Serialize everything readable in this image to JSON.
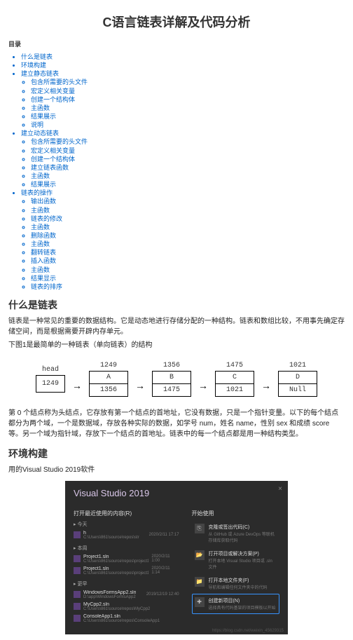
{
  "title": "C语言链表详解及代码分析",
  "toc_label": "目录",
  "toc": [
    {
      "label": "什么是链表"
    },
    {
      "label": "环境构建"
    },
    {
      "label": "建立静态链表",
      "children": [
        {
          "label": "包含所需要的头文件"
        },
        {
          "label": "宏定义相关变量"
        },
        {
          "label": "创建一个结构体"
        },
        {
          "label": "主函数"
        },
        {
          "label": "结果展示"
        },
        {
          "label": "说明"
        }
      ]
    },
    {
      "label": "建立动态链表",
      "children": [
        {
          "label": "包含所需要的头文件"
        },
        {
          "label": "宏定义相关变量"
        },
        {
          "label": "创建一个结构体"
        },
        {
          "label": "建立链表函数"
        },
        {
          "label": "主函数"
        },
        {
          "label": "结果展示"
        }
      ]
    },
    {
      "label": "链表的操作",
      "children": [
        {
          "label": "输出函数"
        },
        {
          "label": "主函数"
        },
        {
          "label": "链表的修改"
        },
        {
          "label": "主函数"
        },
        {
          "label": "删除函数"
        },
        {
          "label": "主函数"
        },
        {
          "label": "翻转链表"
        },
        {
          "label": "插入函数"
        },
        {
          "label": "主函数"
        },
        {
          "label": "结果显示"
        },
        {
          "label": "链表的排序"
        }
      ]
    }
  ],
  "section1": {
    "heading": "什么是链表",
    "p1": "链表是一种常见的重要的数据结构。它是动态地进行存储分配的一种结构。链表和数组比较，不用事先确定存储空间，而是根据需要开辟内存单元。",
    "p2": "下图1是最简单的一种链表（单向链表）的结构"
  },
  "diagram": {
    "head": "head",
    "head_val": "1249",
    "nodes": [
      {
        "addr": "1249",
        "top": "A",
        "bot": "1356"
      },
      {
        "addr": "1356",
        "top": "B",
        "bot": "1475"
      },
      {
        "addr": "1475",
        "top": "C",
        "bot": "1021"
      },
      {
        "addr": "1021",
        "top": "D",
        "bot": "Null"
      }
    ]
  },
  "para_after_diagram": "第 0 个结点称为头结点，它存放有第一个结点的首地址，它没有数据，只是一个指针变量。以下的每个结点都分为两个域，一个是数据域，存放各种实际的数据，如学号 num，姓名 name，性别 sex 和成绩 score 等。另一个域为指针域，存放下一个结点的首地址。链表中的每一个结点都是用一种结构类型。",
  "section2": {
    "heading": "环境构建",
    "p1": "用的Visual Studio 2019软件"
  },
  "vs": {
    "title": "Visual Studio 2019",
    "left_h": "打开最近使用的内容(R)",
    "right_h": "开始使用",
    "groups": [
      {
        "label": "▸ 今天",
        "items": [
          {
            "name": "h",
            "path": "C:\\Users\\861\\source\\repos\\str",
            "date": "2020/2/11 17:17"
          }
        ]
      },
      {
        "label": "▸ 本周",
        "items": [
          {
            "name": "Project1.sln",
            "path": "C:\\Users\\861\\source\\repos\\project1",
            "date": "2020/2/11 1:00"
          },
          {
            "name": "Project1.sln",
            "path": "C:\\Users\\861\\source\\repos\\project1",
            "date": "2020/2/11 1:14"
          }
        ]
      },
      {
        "label": "▸ 更早",
        "items": [
          {
            "name": "WindowsFormsApp2.sln",
            "path": "D:\\app\\WindowsFormsApp2",
            "date": "2019/12/19 12:40"
          },
          {
            "name": "MyCpp2.sln",
            "path": "C:\\Users\\861\\source\\repos\\MyCpp2",
            "date": ""
          },
          {
            "name": "ConsoleApp1.sln",
            "path": "C:\\Users\\861\\source\\repos\\ConsoleApp1",
            "date": ""
          }
        ]
      }
    ],
    "right_items": [
      {
        "icon": "⎘",
        "t1": "克隆或签出代码(C)",
        "t2": "从 GitHub 或 Azure DevOps 等联机存储库获取代码"
      },
      {
        "icon": "📂",
        "t1": "打开项目或解决方案(P)",
        "t2": "打开本地 Visual Studio 项目或 .sln 文件"
      },
      {
        "icon": "📁",
        "t1": "打开本地文件夹(F)",
        "t2": "导航和编辑任何文件夹中的代码"
      },
      {
        "icon": "✚",
        "t1": "创建新项目(N)",
        "t2": "选择具有代码基架的项目模板以开始",
        "hl": true
      }
    ],
    "watermark": "https://blog.csdn.net/weixin_45629315"
  }
}
